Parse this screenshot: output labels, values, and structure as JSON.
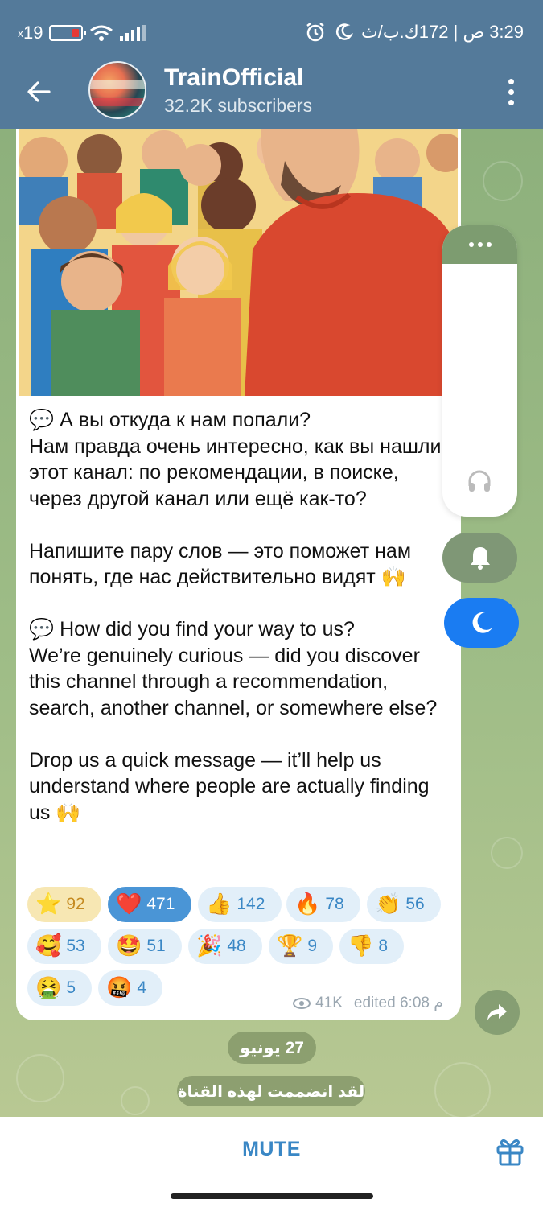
{
  "status_bar": {
    "left_text": "19",
    "left_prefix": "x",
    "right_text": "3:29 ص | 172ك.ب/ث"
  },
  "header": {
    "title": "TrainOfficial",
    "subtitle": "32.2K subscribers"
  },
  "message": {
    "text": "💬 А вы откуда к нам попали?\nНам правда очень интересно, как вы нашли этот канал: по рекомендации, в поиске, через другой канал или ещё как-то?\n\nНапишите пару слов — это поможет нам понять, где нас действительно видят 🙌\n\n💬 How did you find your way to us?\nWe’re genuinely curious — did you discover this channel through a recommendation, search, another channel, or somewhere else?\n\nDrop us a quick message — it’ll help us understand where people are actually finding us 🙌",
    "views": "41K",
    "edited": "edited 6:08 م"
  },
  "reactions": [
    {
      "emoji": "⭐",
      "count": "92"
    },
    {
      "emoji": "❤️",
      "count": "471"
    },
    {
      "emoji": "👍",
      "count": "142"
    },
    {
      "emoji": "🔥",
      "count": "78"
    },
    {
      "emoji": "👏",
      "count": "56"
    },
    {
      "emoji": "🥰",
      "count": "53"
    },
    {
      "emoji": "🤩",
      "count": "51"
    },
    {
      "emoji": "🎉",
      "count": "48"
    },
    {
      "emoji": "🏆",
      "count": "9"
    },
    {
      "emoji": "👎",
      "count": "8"
    },
    {
      "emoji": "🤮",
      "count": "5"
    },
    {
      "emoji": "🤬",
      "count": "4"
    }
  ],
  "date_separator": "27 يونيو",
  "service_message": "لقد انضممت لهذه القناة",
  "bottom": {
    "mute_label": "MUTE"
  },
  "icons": {
    "back": "arrow-left-icon",
    "menu": "kebab-menu-icon",
    "share": "share-icon",
    "headphones": "headphones-icon",
    "bell": "bell-icon",
    "moon": "moon-icon",
    "gift": "gift-icon"
  },
  "colors": {
    "header": "#547a9a",
    "accent": "#3a87c5",
    "moon_button": "#1a7cf2"
  }
}
